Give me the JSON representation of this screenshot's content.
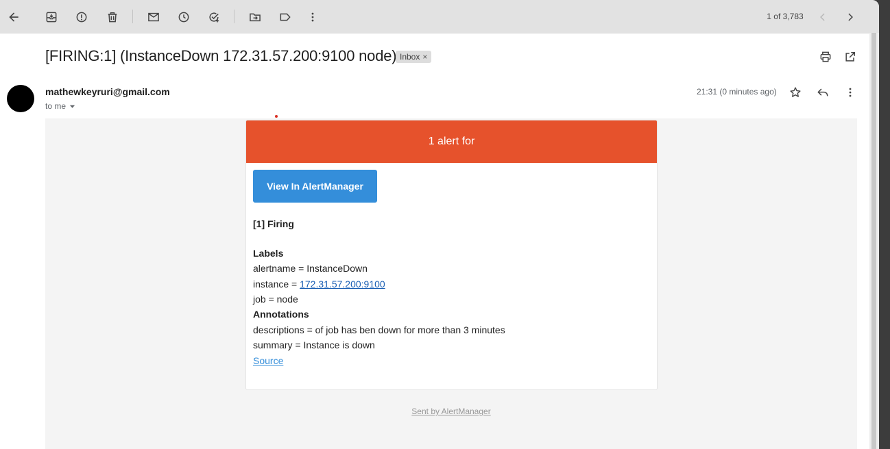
{
  "toolbar": {
    "icons": [
      "back-arrow-icon",
      "archive-icon",
      "report-spam-icon",
      "delete-icon",
      "mark-unread-icon",
      "snooze-icon",
      "add-task-icon",
      "move-to-icon",
      "label-icon",
      "more-vert-icon"
    ],
    "pager": "1 of 3,783"
  },
  "email": {
    "subject": "[FIRING:1] (InstanceDown 172.31.57.200:9100 node)",
    "inbox_chip": "Inbox",
    "chip_close": "×",
    "sender": "mathewkeyruri@gmail.com",
    "to_me": "to me",
    "time": "21:31 (0 minutes ago)"
  },
  "alert": {
    "header": "1 alert for",
    "header_color": "#e6522c",
    "button": "View In AlertManager",
    "button_color": "#348eda",
    "firing": "[1] Firing",
    "labels_title": "Labels",
    "alertname": "alertname = InstanceDown",
    "instance_prefix": "instance = ",
    "instance_link": "172.31.57.200:9100",
    "job": "job = node",
    "annotations_title": "Annotations",
    "descriptions": "descriptions = of job has ben down for more than 3 minutes",
    "summary": "summary = Instance is down",
    "source": "Source",
    "footer_link": "Sent by AlertManager"
  }
}
